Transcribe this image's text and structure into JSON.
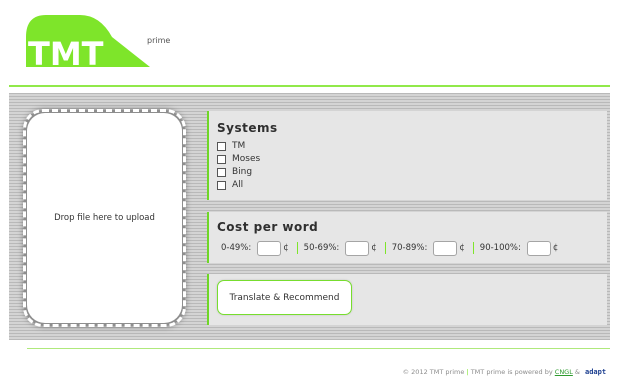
{
  "logo": {
    "text": "TMT",
    "suffix": "prime",
    "color": "#7ee52a"
  },
  "upload": {
    "label": "Drop file here to upload"
  },
  "systems": {
    "title": "Systems",
    "options": [
      {
        "label": "TM",
        "checked": false
      },
      {
        "label": "Moses",
        "checked": false
      },
      {
        "label": "Bing",
        "checked": false
      },
      {
        "label": "All",
        "checked": false
      }
    ]
  },
  "cost": {
    "title": "Cost per word",
    "unit": "¢",
    "ranges": [
      {
        "label": "0-49%:",
        "value": ""
      },
      {
        "label": "50-69%:",
        "value": ""
      },
      {
        "label": "70-89%:",
        "value": ""
      },
      {
        "label": "90-100%:",
        "value": ""
      }
    ]
  },
  "actions": {
    "translate_label": "Translate & Recommend"
  },
  "footer": {
    "copyright": "© 2012 TMT prime",
    "separator": "|",
    "powered": "TMT prime is powered by",
    "link": "CNGL",
    "and": "&",
    "partner": "adapt"
  },
  "colors": {
    "accent": "#7ee52a",
    "panel_dark": "#b9b9b9",
    "panel_light": "#d4d4d4",
    "box": "#e6e6e6"
  }
}
